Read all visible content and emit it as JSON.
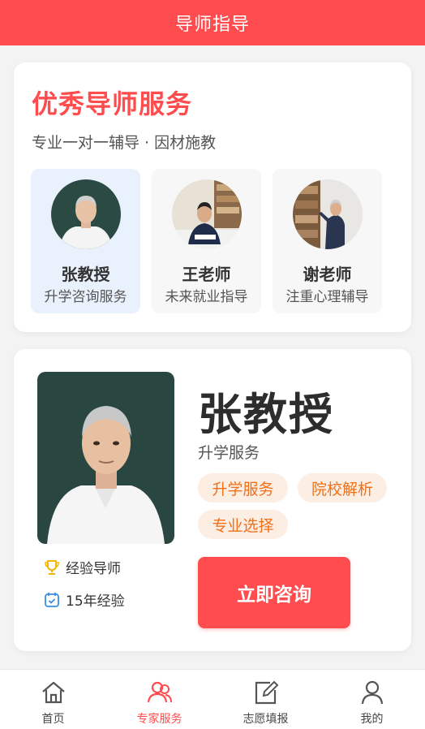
{
  "header": {
    "title": "导师指导"
  },
  "intro": {
    "title": "优秀导师服务",
    "subtitle": "专业一对一辅导 · 因材施教",
    "mentors": [
      {
        "name": "张教授",
        "desc": "升学咨询服务"
      },
      {
        "name": "王老师",
        "desc": "未来就业指导"
      },
      {
        "name": "谢老师",
        "desc": "注重心理辅导"
      }
    ]
  },
  "detail": {
    "name": "张教授",
    "service": "升学服务",
    "tags": [
      "升学服务",
      "院校解析",
      "专业选择"
    ],
    "badge": "经验导师",
    "experience": "15年经验",
    "consult_label": "立即咨询"
  },
  "tabs": [
    {
      "label": "首页",
      "icon": "home-icon",
      "active": false
    },
    {
      "label": "专家服务",
      "icon": "experts-icon",
      "active": true
    },
    {
      "label": "志愿填报",
      "icon": "edit-icon",
      "active": false
    },
    {
      "label": "我的",
      "icon": "user-icon",
      "active": false
    }
  ],
  "colors": {
    "accent": "#ff4d4f",
    "tag_text": "#f0701a",
    "tag_bg": "#fdeee4"
  }
}
